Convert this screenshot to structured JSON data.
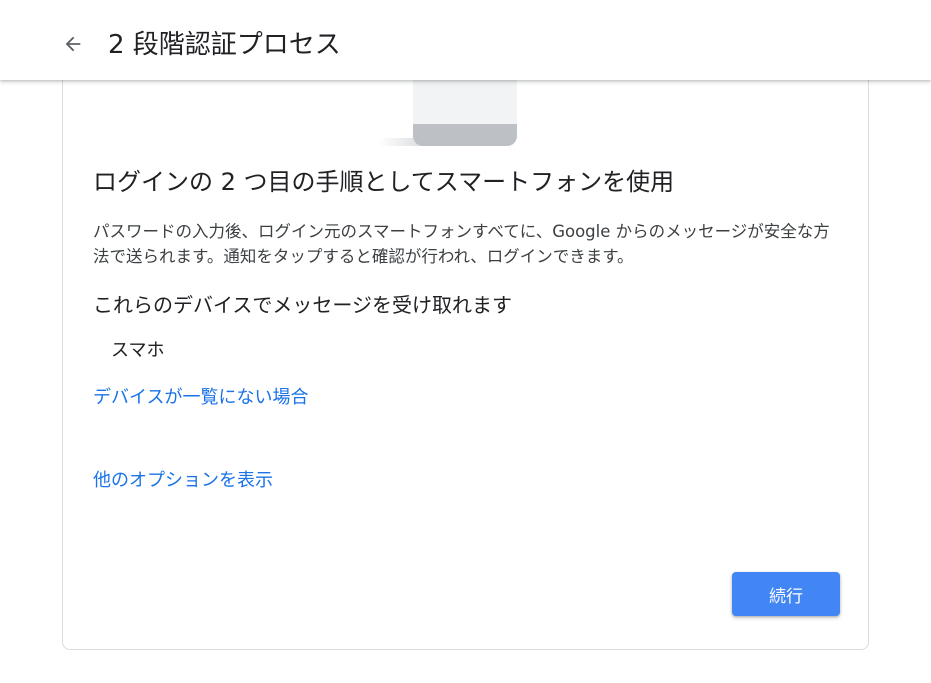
{
  "header": {
    "title": "2 段階認証プロセス",
    "back_icon": "arrow-back-icon"
  },
  "illustration": {
    "icon": "phone-check-bubble-illustration",
    "colors": {
      "bubble": "#e6f4ea",
      "phone": "#f1f3f4",
      "phone_base": "#bdc1c6"
    }
  },
  "main": {
    "heading": "ログインの 2 つ目の手順としてスマートフォンを使用",
    "description": "パスワードの入力後、ログイン元のスマートフォンすべてに、Google からのメッセージが安全な方法で送られます。通知をタップすると確認が行われ、ログインできます。",
    "devices_heading": "これらのデバイスでメッセージを受け取れます",
    "devices": [
      "スマホ"
    ],
    "missing_device_link": "デバイスが一覧にない場合",
    "more_options_link": "他のオプションを表示",
    "continue_label": "続行"
  },
  "colors": {
    "accent": "#4285f4",
    "link": "#1a73e8",
    "text": "#202124"
  }
}
